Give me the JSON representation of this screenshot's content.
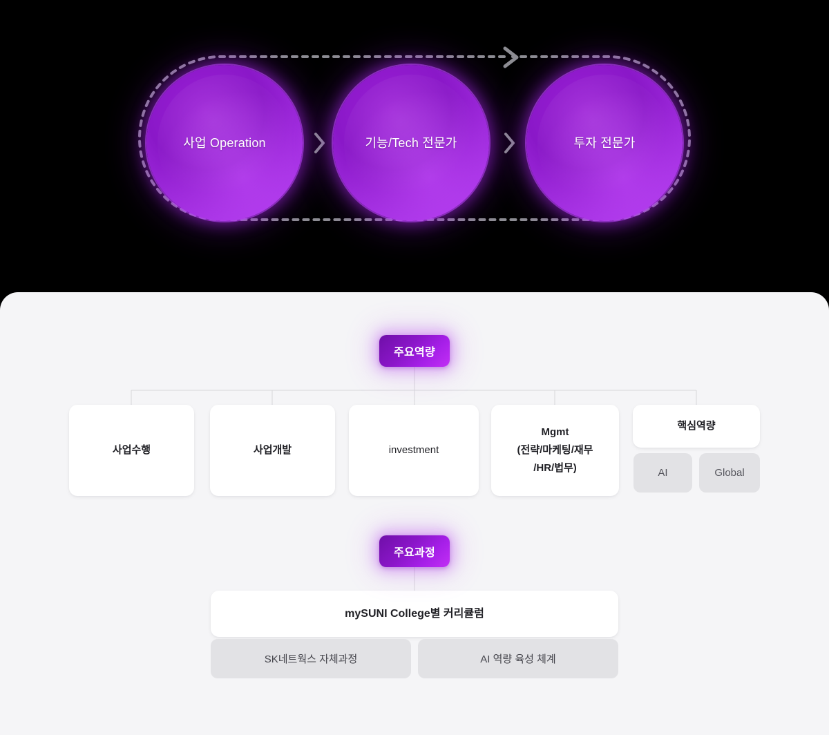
{
  "top_flow": {
    "loop_arrow": "dashed-loop-arrow",
    "steps": [
      {
        "id": "operation",
        "label": "사업\nOperation"
      },
      {
        "id": "tech-expert",
        "label": "기능/Tech\n전문가"
      },
      {
        "id": "investment-expert",
        "label": "투자\n전문가"
      }
    ],
    "separators": [
      "chevron-right-icon",
      "chevron-right-icon"
    ]
  },
  "competency": {
    "badge": "주요역량",
    "cards": [
      {
        "id": "exec",
        "label": "사업수행"
      },
      {
        "id": "bizdev",
        "label": "사업개발"
      },
      {
        "id": "invest",
        "label": "investment"
      },
      {
        "id": "mgmt",
        "label": "Mgmt\n(전략/마케팅/재무\n/HR/법무)"
      },
      {
        "id": "core",
        "label": "핵심역량"
      }
    ],
    "core_chips": [
      {
        "id": "ai",
        "label": "AI"
      },
      {
        "id": "global",
        "label": "Global"
      }
    ]
  },
  "course": {
    "badge": "주요과정",
    "primary_card": "mySUNI College별 커리큘럼",
    "chips": [
      {
        "id": "sk-internal",
        "label": "SK네트웍스 자체과정"
      },
      {
        "id": "ai-capability",
        "label": "AI 역량 육성 체계"
      }
    ]
  },
  "colors": {
    "panel_background": "#f5f5f7",
    "badge_purple_start": "#6f0fa8",
    "badge_purple_end": "#c22ff5",
    "circle_purple": "#9b1fd6",
    "chip_gray": "#e2e2e5",
    "connector_gray": "#d6d6da",
    "dashed_arrow_gray": "#8d8d93"
  }
}
